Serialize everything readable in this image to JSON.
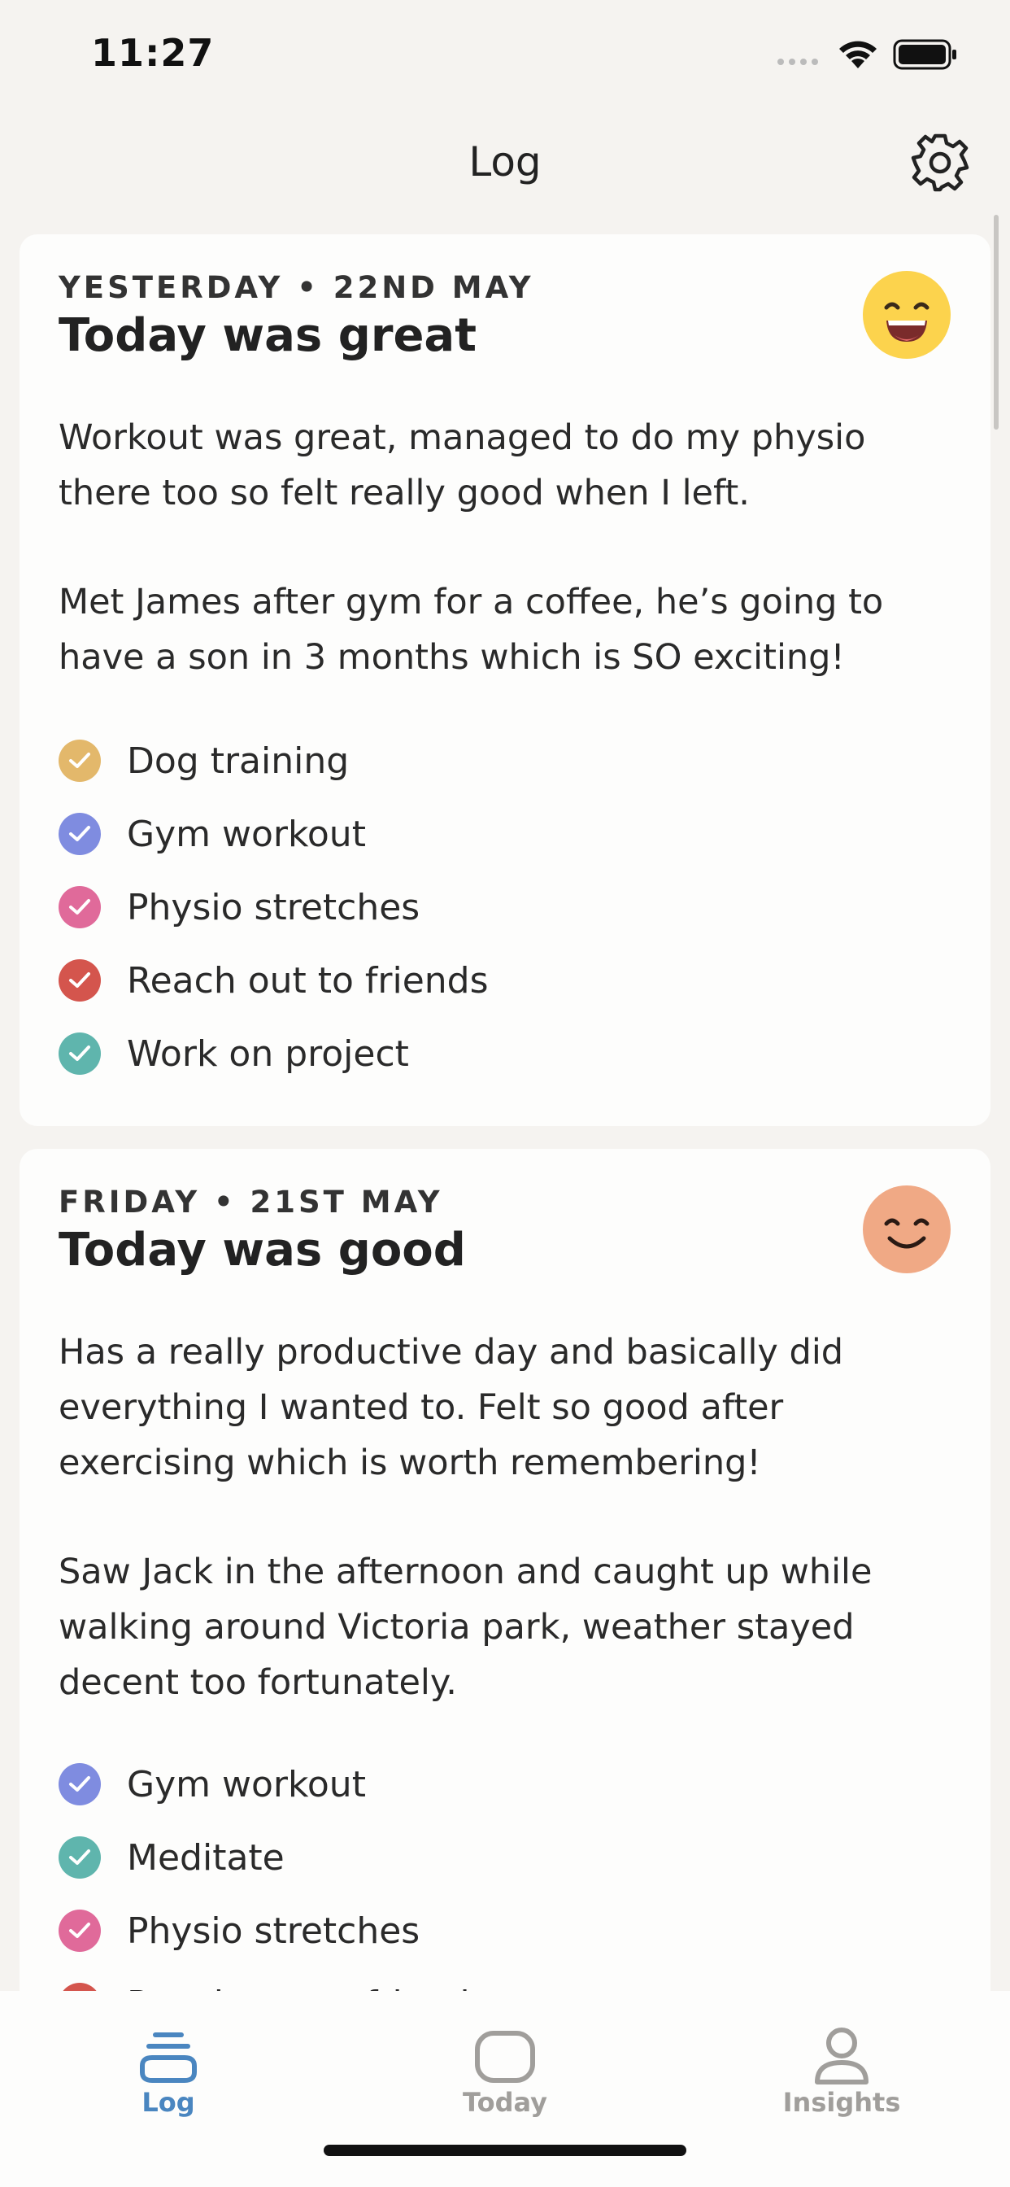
{
  "status_bar": {
    "time": "11:27"
  },
  "nav": {
    "title": "Log",
    "settings_icon": "gear-icon"
  },
  "entries": [
    {
      "date": "YESTERDAY • 22ND MAY",
      "title": "Today was great",
      "mood_icon": "grinning-face-icon",
      "mood_color": "#fcd34d",
      "paragraphs": [
        "Workout was great, managed to do my physio there too so felt really good when I left.",
        "Met James after gym for a coffee, he’s going to have a son in 3 months which is SO exciting!"
      ],
      "habits": [
        {
          "label": "Dog training",
          "color": "#e3b86b"
        },
        {
          "label": "Gym workout",
          "color": "#7f8ce0"
        },
        {
          "label": "Physio stretches",
          "color": "#e06a9a"
        },
        {
          "label": "Reach out to friends",
          "color": "#d4554d"
        },
        {
          "label": "Work on project",
          "color": "#5fb5ad"
        }
      ]
    },
    {
      "date": "FRIDAY • 21ST MAY",
      "title": "Today was good",
      "mood_icon": "smiling-face-icon",
      "mood_color": "#f0a985",
      "paragraphs": [
        "Has a really productive day and basically did everything I wanted to. Felt so good after exercising which is worth remembering!",
        "Saw Jack in the afternoon and caught up while walking around Victoria park, weather stayed decent too fortunately."
      ],
      "habits": [
        {
          "label": "Gym workout",
          "color": "#7f8ce0"
        },
        {
          "label": "Meditate",
          "color": "#5fb5ad"
        },
        {
          "label": "Physio stretches",
          "color": "#e06a9a"
        },
        {
          "label": "Reach out to friends",
          "color": "#d4554d"
        }
      ]
    }
  ],
  "tabs": [
    {
      "label": "Log",
      "icon": "log-stack-icon",
      "active": true,
      "color": "#4a86c0"
    },
    {
      "label": "Today",
      "icon": "today-square-icon",
      "active": false,
      "color": "#a09e9b"
    },
    {
      "label": "Insights",
      "icon": "person-icon",
      "active": false,
      "color": "#a09e9b"
    }
  ]
}
